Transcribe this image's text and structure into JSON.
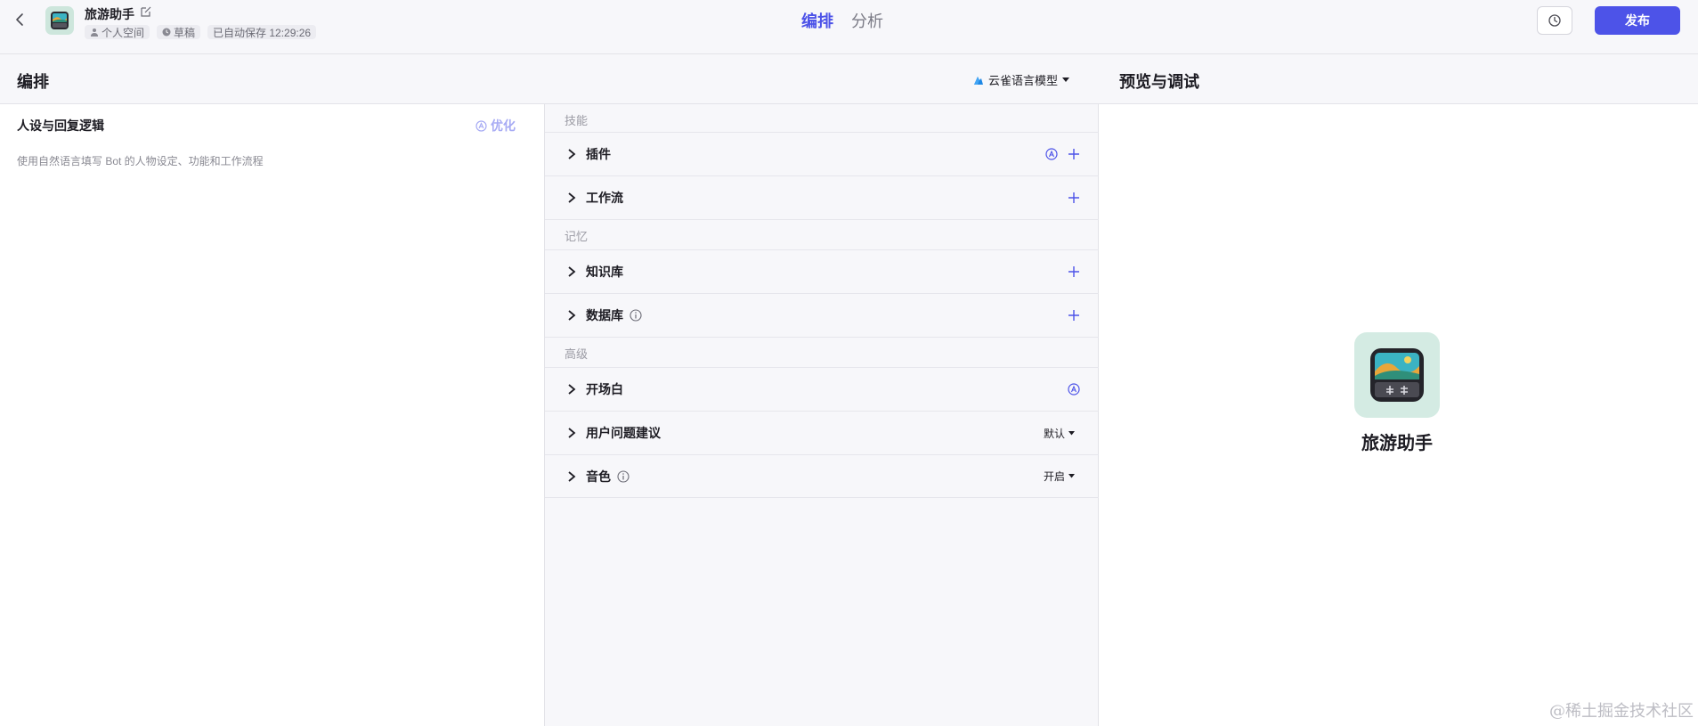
{
  "app": {
    "bot_name": "旅游助手",
    "meta": {
      "space": "个人空间",
      "status": "草稿",
      "autosave": "已自动保存 12:29:26"
    }
  },
  "header": {
    "tabs": [
      {
        "label": "编排",
        "active": true
      },
      {
        "label": "分析",
        "active": false
      }
    ],
    "publish_label": "发布"
  },
  "editor": {
    "title": "编排",
    "model": "云雀语言模型",
    "persona": {
      "title": "人设与回复逻辑",
      "optimize_label": "优化",
      "placeholder": "使用自然语言填写 Bot 的人物设定、功能和工作流程"
    }
  },
  "sections": {
    "skills": {
      "label": "技能",
      "items": [
        {
          "label": "插件",
          "auto": true,
          "add": true
        },
        {
          "label": "工作流",
          "add": true
        }
      ]
    },
    "memory": {
      "label": "记忆",
      "items": [
        {
          "label": "知识库",
          "add": true
        },
        {
          "label": "数据库",
          "info": true,
          "add": true
        }
      ]
    },
    "advanced": {
      "label": "高级",
      "items": [
        {
          "label": "开场白",
          "auto": true
        },
        {
          "label": "用户问题建议",
          "value": "默认"
        },
        {
          "label": "音色",
          "info": true,
          "value": "开启"
        }
      ]
    }
  },
  "preview": {
    "title": "预览与调试",
    "bot_name": "旅游助手"
  },
  "watermark": "@稀土掘金技术社区",
  "colors": {
    "accent": "#4d53e8",
    "accent_light": "#a7abf4",
    "panel_bg": "#f7f7fa",
    "avatar_bg": "#d4ebe3"
  },
  "icons": {
    "back": "chevron-left-icon",
    "edit": "edit-icon",
    "space": "user-icon",
    "status": "clock-icon",
    "history": "history-icon",
    "model": "model-logo-icon",
    "optimize": "auto-icon",
    "expand": "chevron-right-icon",
    "add": "plus-icon",
    "info": "info-icon",
    "dropdown": "caret-down-icon"
  }
}
